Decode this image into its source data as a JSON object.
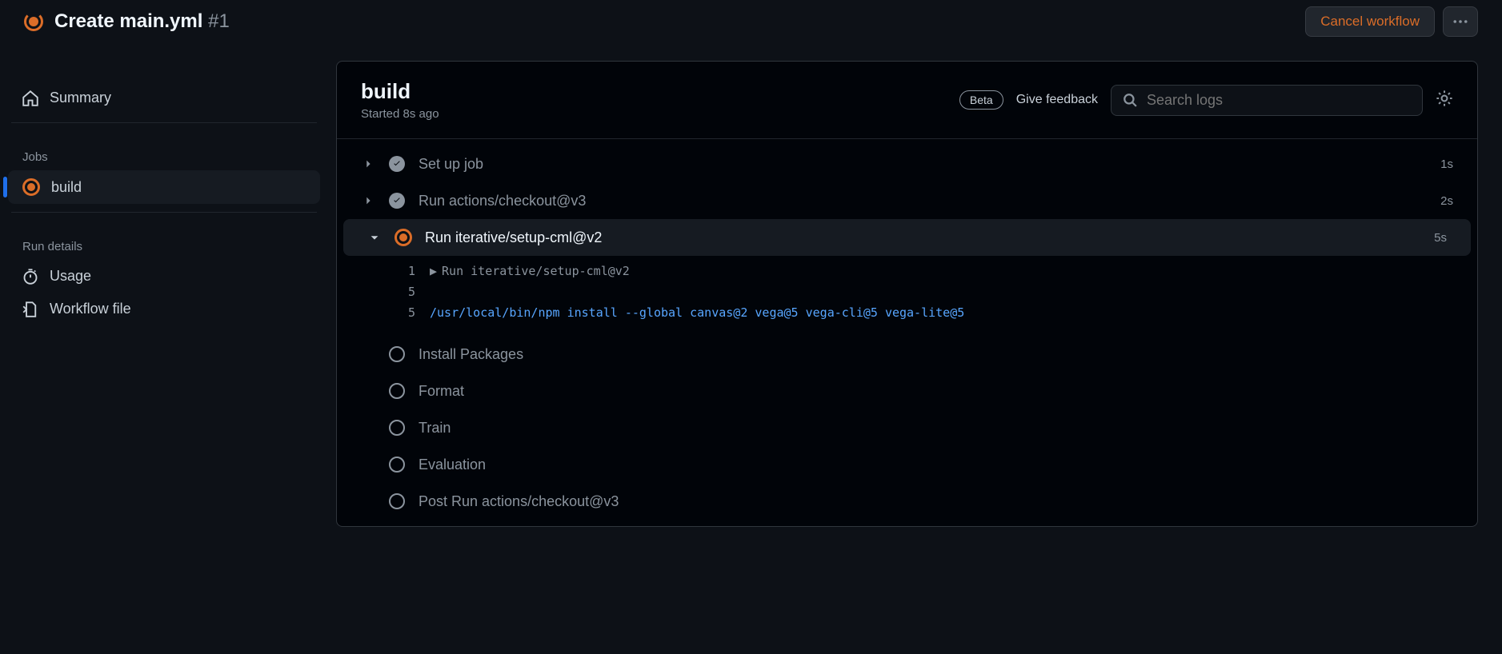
{
  "header": {
    "title": "Create main.yml",
    "run_num": "#1",
    "cancel_label": "Cancel workflow"
  },
  "sidebar": {
    "summary": "Summary",
    "jobs_label": "Jobs",
    "job_name": "build",
    "run_details_label": "Run details",
    "usage": "Usage",
    "workflow_file": "Workflow file"
  },
  "main": {
    "title": "build",
    "subtitle": "Started 8s ago",
    "beta": "Beta",
    "feedback": "Give feedback",
    "search_placeholder": "Search logs"
  },
  "steps": [
    {
      "name": "Set up job",
      "duration": "1s",
      "status": "success",
      "chevron": "right"
    },
    {
      "name": "Run actions/checkout@v3",
      "duration": "2s",
      "status": "success",
      "chevron": "right"
    },
    {
      "name": "Run iterative/setup-cml@v2",
      "duration": "5s",
      "status": "running",
      "chevron": "down",
      "expanded": true
    },
    {
      "name": "Install Packages",
      "status": "pending"
    },
    {
      "name": "Format",
      "status": "pending"
    },
    {
      "name": "Train",
      "status": "pending"
    },
    {
      "name": "Evaluation",
      "status": "pending"
    },
    {
      "name": "Post Run actions/checkout@v3",
      "status": "pending"
    }
  ],
  "log": {
    "lines": [
      {
        "n": "1",
        "text": "Run iterative/setup-cml@v2",
        "tri": true
      },
      {
        "n": "5",
        "text": ""
      },
      {
        "n": "5",
        "text": "/usr/local/bin/npm install --global canvas@2 vega@5 vega-cli@5 vega-lite@5",
        "cmd": true
      }
    ]
  }
}
